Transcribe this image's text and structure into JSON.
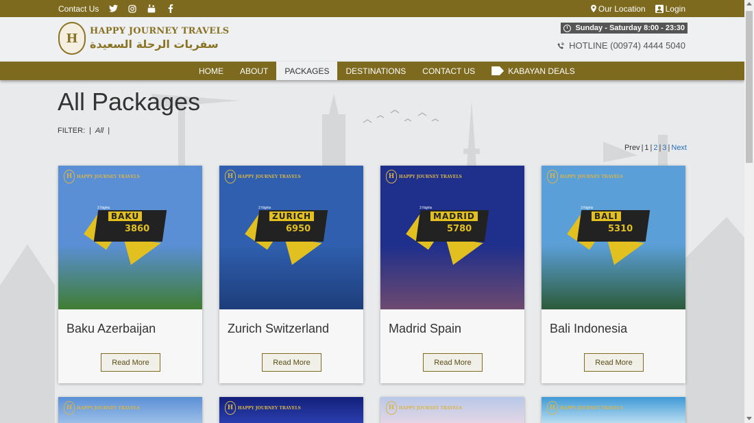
{
  "topbar": {
    "contact_label": "Contact Us",
    "location_label": "Our Location",
    "login_label": "Login",
    "social_icons": [
      "twitter-icon",
      "instagram-icon",
      "youtube-icon",
      "facebook-icon"
    ]
  },
  "header": {
    "brand_en": "HAPPY JOURNEY TRAVELS",
    "brand_ar": "سفريات الرحلة السعيدة",
    "hours": "Sunday - Saturday  8:00 - 23:30",
    "hotline": "HOTLINE (00974) 4444 5040"
  },
  "nav": {
    "items": [
      {
        "label": "HOME"
      },
      {
        "label": "ABOUT"
      },
      {
        "label": "PACKAGES",
        "active": true
      },
      {
        "label": "DESTINATIONS"
      },
      {
        "label": "CONTACT US"
      },
      {
        "label": "KABAYAN DEALS"
      }
    ]
  },
  "main": {
    "title": "All Packages",
    "filter_label": "FILTER:",
    "filter_all": "All",
    "pager": {
      "prev": "Prev",
      "pages": [
        "1",
        "2",
        "3"
      ],
      "next": "Next"
    }
  },
  "packages": [
    {
      "name": "Baku Azerbaijan",
      "city": "BAKU",
      "price": "3860",
      "nights": "3 Nights",
      "button": "Read More",
      "sky": "#5a8fd6",
      "ground": "#3f7d33"
    },
    {
      "name": "Zurich Switzerland",
      "city": "ZURICH",
      "price": "6950",
      "nights": "3 Nights",
      "button": "Read More",
      "sky": "#2f5fae",
      "ground": "#1d3d7a"
    },
    {
      "name": "Madrid Spain",
      "city": "MADRID",
      "price": "5780",
      "nights": "3 Nights",
      "button": "Read More",
      "sky": "#1e2f8c",
      "ground": "#6d4a70"
    },
    {
      "name": "Bali Indonesia",
      "city": "BALI",
      "price": "5310",
      "nights": "3 Nights",
      "button": "Read More",
      "sky": "#5b9fd8",
      "ground": "#2c5b3a"
    }
  ],
  "colors": {
    "brand": "#7d6a1f",
    "accent": "#e2c01f",
    "link": "#2a6ebd"
  }
}
